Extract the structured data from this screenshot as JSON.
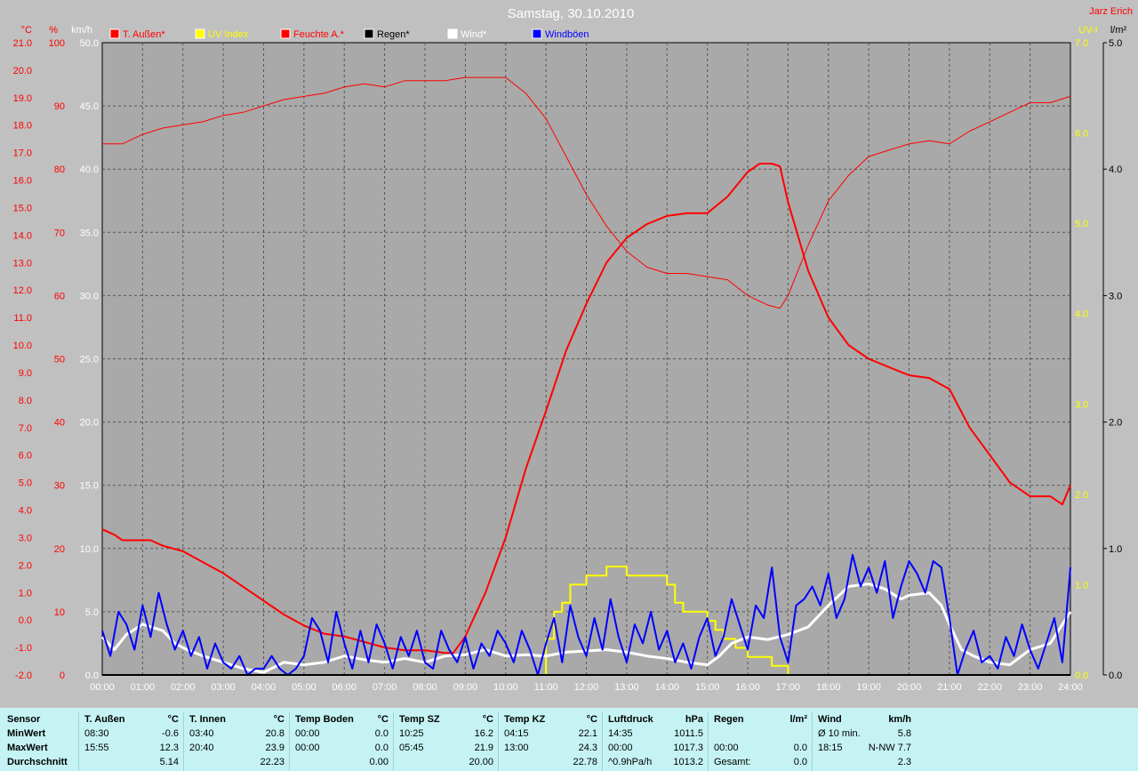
{
  "title": "Samstag, 30.10.2010",
  "author": "Jarz Erich",
  "legend": [
    {
      "label": "T. Außen*",
      "color": "#ff0000"
    },
    {
      "label": "UV Index",
      "color": "#ffff00"
    },
    {
      "label": "Feuchte A.*",
      "color": "#ff0000"
    },
    {
      "label": "Regen*",
      "color": "#000000"
    },
    {
      "label": "Wind*",
      "color": "#ffffff"
    },
    {
      "label": "Windböen",
      "color": "#0000ff"
    }
  ],
  "axis_units": {
    "temp": "°C",
    "hum": "%",
    "wind": "km/h",
    "uv": "UV-I",
    "rain": "l/m²"
  },
  "chart_data": {
    "type": "line",
    "x_ticks": [
      "00:00",
      "01:00",
      "02:00",
      "03:00",
      "04:00",
      "05:00",
      "06:00",
      "07:00",
      "08:00",
      "09:00",
      "10:00",
      "11:00",
      "12:00",
      "13:00",
      "14:00",
      "15:00",
      "16:00",
      "17:00",
      "18:00",
      "19:00",
      "20:00",
      "21:00",
      "22:00",
      "23:00",
      "24:00"
    ],
    "axes": {
      "temp": {
        "label": "°C",
        "ylim": [
          -2,
          21
        ],
        "ticks": [
          "21.0",
          "20.0",
          "19.0",
          "18.0",
          "17.0",
          "16.0",
          "15.0",
          "14.0",
          "13.0",
          "12.0",
          "11.0",
          "10.0",
          "9.0",
          "8.0",
          "7.0",
          "6.0",
          "5.0",
          "4.0",
          "3.0",
          "2.0",
          "1.0",
          "0.0",
          "-1.0",
          "-2.0"
        ]
      },
      "hum": {
        "label": "%",
        "ylim": [
          0,
          100
        ],
        "ticks": [
          "100",
          "90",
          "80",
          "70",
          "60",
          "50",
          "40",
          "30",
          "20",
          "10",
          "0"
        ]
      },
      "wind": {
        "label": "km/h",
        "ylim": [
          0,
          50
        ],
        "ticks": [
          "50.0",
          "45.0",
          "40.0",
          "35.0",
          "30.0",
          "25.0",
          "20.0",
          "15.0",
          "10.0",
          "5.0",
          "0.0"
        ]
      },
      "uv": {
        "label": "UV-I",
        "ylim": [
          0,
          7
        ],
        "ticks": [
          "7.0",
          "6.0",
          "5.0",
          "4.0",
          "3.0",
          "2.0",
          "1.0",
          "0.0"
        ]
      },
      "rain": {
        "label": "l/m²",
        "ylim": [
          0,
          5
        ],
        "ticks": [
          "5.0",
          "4.0",
          "3.0",
          "2.0",
          "1.0",
          "0.0"
        ]
      }
    },
    "series": [
      {
        "name": "T. Außen*",
        "axis": "temp",
        "color": "#ff0000",
        "width": 2,
        "x": [
          0,
          0.3,
          0.5,
          1.0,
          1.2,
          1.5,
          2.0,
          2.5,
          3.0,
          3.5,
          4.0,
          4.5,
          5.0,
          5.5,
          6.0,
          6.5,
          7.0,
          7.5,
          8.0,
          8.5,
          8.7,
          9.0,
          9.5,
          10.0,
          10.5,
          11.0,
          11.5,
          12.0,
          12.5,
          13.0,
          13.5,
          14.0,
          14.5,
          15.0,
          15.5,
          16.0,
          16.3,
          16.6,
          16.8,
          17.0,
          17.5,
          18.0,
          18.5,
          19.0,
          19.5,
          20.0,
          20.5,
          21.0,
          21.5,
          22.0,
          22.5,
          23.0,
          23.5,
          23.8,
          24.0
        ],
        "y": [
          3.3,
          3.1,
          2.9,
          2.9,
          2.9,
          2.7,
          2.5,
          2.1,
          1.7,
          1.2,
          0.7,
          0.2,
          -0.2,
          -0.5,
          -0.6,
          -0.8,
          -1.0,
          -1.1,
          -1.1,
          -1.2,
          -1.2,
          -0.6,
          1.0,
          3.0,
          5.5,
          7.6,
          9.8,
          11.5,
          13.0,
          13.9,
          14.4,
          14.7,
          14.8,
          14.8,
          15.4,
          16.3,
          16.6,
          16.6,
          16.5,
          15.2,
          12.7,
          11.0,
          10.0,
          9.5,
          9.2,
          8.9,
          8.8,
          8.4,
          7.0,
          6.0,
          5.0,
          4.5,
          4.5,
          4.2,
          4.9
        ]
      },
      {
        "name": "Feuchte A.*",
        "axis": "hum",
        "color": "#ff0000",
        "width": 1,
        "x": [
          0,
          0.5,
          1.0,
          1.5,
          2.0,
          2.5,
          3.0,
          3.5,
          4.0,
          4.5,
          5.0,
          5.5,
          6.0,
          6.5,
          7.0,
          7.5,
          8.0,
          8.5,
          9.0,
          9.5,
          10.0,
          10.5,
          11.0,
          11.5,
          12.0,
          12.5,
          13.0,
          13.5,
          14.0,
          14.5,
          15.0,
          15.5,
          16.0,
          16.5,
          16.8,
          17.0,
          17.5,
          18.0,
          18.5,
          19.0,
          19.5,
          20.0,
          20.5,
          21.0,
          21.5,
          22.0,
          22.5,
          23.0,
          23.5,
          24.0
        ],
        "y": [
          84,
          84,
          85.5,
          86.5,
          87,
          87.5,
          88.5,
          89,
          90,
          91,
          91.5,
          92,
          93,
          93.5,
          93,
          94,
          94,
          94,
          94.5,
          94.5,
          94.5,
          92,
          88,
          82,
          76,
          71,
          67,
          64.5,
          63.5,
          63.5,
          63,
          62.5,
          60,
          58.5,
          58,
          60,
          68,
          75,
          79,
          82,
          83,
          84,
          84.5,
          84,
          86,
          87.5,
          89,
          90.5,
          90.5,
          91.5
        ]
      },
      {
        "name": "UV Index",
        "axis": "uv",
        "color": "#ffff00",
        "width": 2,
        "step": true,
        "x": [
          0,
          10.9,
          11.0,
          11.2,
          11.4,
          11.6,
          12.0,
          12.5,
          12.8,
          13.0,
          13.5,
          14.0,
          14.2,
          14.4,
          14.6,
          15.0,
          15.2,
          15.4,
          15.7,
          16.0,
          16.3,
          16.6,
          17.0,
          24.0
        ],
        "y": [
          0,
          0,
          0.4,
          0.7,
          0.8,
          1.0,
          1.1,
          1.2,
          1.2,
          1.1,
          1.1,
          1.0,
          0.8,
          0.7,
          0.7,
          0.6,
          0.5,
          0.4,
          0.3,
          0.2,
          0.2,
          0.1,
          0,
          0
        ]
      },
      {
        "name": "Wind*",
        "axis": "wind",
        "color": "#ffffff",
        "width": 3,
        "x": [
          0,
          0.3,
          0.6,
          1.0,
          1.5,
          1.8,
          2.1,
          2.5,
          3.0,
          3.5,
          4.0,
          4.5,
          5.0,
          5.5,
          6.0,
          6.5,
          7.0,
          7.5,
          8.0,
          8.5,
          9.0,
          9.5,
          10.0,
          10.5,
          11.0,
          11.5,
          12.0,
          12.5,
          13.0,
          13.5,
          14.0,
          14.5,
          15.0,
          15.3,
          15.6,
          16.0,
          16.5,
          17.0,
          17.5,
          18.0,
          18.5,
          19.0,
          19.4,
          19.8,
          20.0,
          20.5,
          20.8,
          21.0,
          21.3,
          21.6,
          22.0,
          22.5,
          23.0,
          23.5,
          24.0
        ],
        "y": [
          3.0,
          2.0,
          3.2,
          4.0,
          3.5,
          2.5,
          2.0,
          1.5,
          1.0,
          0.5,
          0.2,
          1.0,
          0.8,
          1.0,
          1.5,
          1.2,
          1.0,
          1.3,
          1.0,
          1.5,
          1.6,
          2.0,
          1.5,
          1.6,
          1.5,
          1.8,
          1.9,
          2.0,
          1.8,
          1.5,
          1.3,
          1.0,
          0.8,
          1.5,
          2.5,
          3.0,
          2.8,
          3.2,
          3.8,
          5.5,
          7.0,
          7.2,
          6.8,
          6.0,
          6.3,
          6.5,
          5.5,
          4.0,
          2.0,
          1.5,
          1.0,
          0.8,
          2.0,
          2.5,
          5.0
        ]
      },
      {
        "name": "Windböen",
        "axis": "wind",
        "color": "#0000ff",
        "width": 2,
        "x": [
          0,
          0.2,
          0.4,
          0.6,
          0.8,
          1.0,
          1.2,
          1.4,
          1.6,
          1.8,
          2.0,
          2.2,
          2.4,
          2.6,
          2.8,
          3.0,
          3.2,
          3.4,
          3.6,
          3.8,
          4.0,
          4.2,
          4.4,
          4.6,
          4.8,
          5.0,
          5.2,
          5.4,
          5.6,
          5.8,
          6.0,
          6.2,
          6.4,
          6.6,
          6.8,
          7.0,
          7.2,
          7.4,
          7.6,
          7.8,
          8.0,
          8.2,
          8.4,
          8.6,
          8.8,
          9.0,
          9.2,
          9.4,
          9.6,
          9.8,
          10.0,
          10.2,
          10.4,
          10.6,
          10.8,
          11.0,
          11.2,
          11.4,
          11.6,
          11.8,
          12.0,
          12.2,
          12.4,
          12.6,
          12.8,
          13.0,
          13.2,
          13.4,
          13.6,
          13.8,
          14.0,
          14.2,
          14.4,
          14.6,
          14.8,
          15.0,
          15.2,
          15.4,
          15.6,
          15.8,
          16.0,
          16.2,
          16.4,
          16.6,
          16.8,
          17.0,
          17.2,
          17.4,
          17.6,
          17.8,
          18.0,
          18.2,
          18.4,
          18.6,
          18.8,
          19.0,
          19.2,
          19.4,
          19.6,
          19.8,
          20.0,
          20.2,
          20.4,
          20.6,
          20.8,
          21.0,
          21.2,
          21.4,
          21.6,
          21.8,
          22.0,
          22.2,
          22.4,
          22.6,
          22.8,
          23.0,
          23.2,
          23.4,
          23.6,
          23.8,
          24.0
        ],
        "y": [
          3.5,
          1.5,
          5.0,
          4.0,
          2.0,
          5.5,
          3.0,
          6.5,
          4.0,
          2.0,
          3.5,
          1.5,
          3.0,
          0.5,
          2.5,
          1.0,
          0.5,
          1.5,
          0,
          0.5,
          0.5,
          1.5,
          0.5,
          0,
          0.5,
          1.5,
          4.5,
          3.5,
          1.0,
          5.0,
          2.5,
          0.5,
          3.5,
          1.0,
          4.0,
          2.5,
          0.5,
          3.0,
          1.5,
          3.5,
          1.0,
          0.5,
          3.5,
          2.0,
          1.0,
          3.0,
          0.5,
          2.5,
          1.5,
          3.5,
          2.5,
          1.0,
          3.5,
          2.0,
          0,
          2.5,
          4.5,
          1.0,
          5.5,
          3.0,
          1.5,
          4.5,
          2.0,
          6.0,
          3.0,
          1.0,
          4.0,
          2.5,
          5.0,
          2.0,
          3.5,
          1.0,
          2.5,
          0.5,
          3.0,
          4.5,
          1.5,
          3.0,
          6.0,
          4.0,
          2.0,
          5.5,
          4.5,
          8.5,
          3.0,
          1.0,
          5.5,
          6.0,
          7.0,
          5.5,
          8.0,
          4.5,
          6.0,
          9.5,
          7.0,
          8.5,
          6.5,
          9.0,
          4.5,
          7.0,
          9.0,
          8.0,
          6.5,
          9.0,
          8.5,
          4.5,
          0,
          2.0,
          3.5,
          1.0,
          1.5,
          0.5,
          3.0,
          1.5,
          4.0,
          2.0,
          0.5,
          2.5,
          4.5,
          1.0,
          8.5
        ]
      },
      {
        "name": "Regen*",
        "axis": "rain",
        "color": "#000000",
        "width": 2,
        "x": [
          0,
          24
        ],
        "y": [
          0,
          0
        ]
      }
    ]
  },
  "stats": {
    "row_labels": [
      "Sensor",
      "MinWert",
      "MaxWert",
      "Durchschnitt"
    ],
    "columns": [
      {
        "header": "T. Außen",
        "unit": "°C",
        "min_time": "08:30",
        "min": "-0.6",
        "max_time": "15:55",
        "max": "12.3",
        "avg_label": "",
        "avg": "5.14"
      },
      {
        "header": "T. Innen",
        "unit": "°C",
        "min_time": "03:40",
        "min": "20.8",
        "max_time": "20:40",
        "max": "23.9",
        "avg_label": "",
        "avg": "22.23"
      },
      {
        "header": "Temp Boden",
        "unit": "°C",
        "min_time": "00:00",
        "min": "0.0",
        "max_time": "00:00",
        "max": "0.0",
        "avg_label": "",
        "avg": "0.00"
      },
      {
        "header": "Temp SZ",
        "unit": "°C",
        "min_time": "10:25",
        "min": "16.2",
        "max_time": "05:45",
        "max": "21.9",
        "avg_label": "",
        "avg": "20.00"
      },
      {
        "header": "Temp KZ",
        "unit": "°C",
        "min_time": "04:15",
        "min": "22.1",
        "max_time": "13:00",
        "max": "24.3",
        "avg_label": "",
        "avg": "22.78"
      },
      {
        "header": "Luftdruck",
        "unit": "hPa",
        "min_time": "14:35",
        "min": "1011.5",
        "max_time": "00:00",
        "max": "1017.3",
        "avg_label": "^0.9hPa/h",
        "avg": "1013.2"
      },
      {
        "header": "Regen",
        "unit": "l/m²",
        "min_time": "",
        "min": "",
        "max_time": "00:00",
        "max": "0.0",
        "avg_label": "Gesamt:",
        "avg": "0.0"
      },
      {
        "header": "Wind",
        "unit": "km/h",
        "min_time": "Ø 10 min.",
        "min": "5.8",
        "max_time": "18:15",
        "max": "N-NW 7.7",
        "avg_label": "",
        "avg": "2.3"
      }
    ]
  }
}
